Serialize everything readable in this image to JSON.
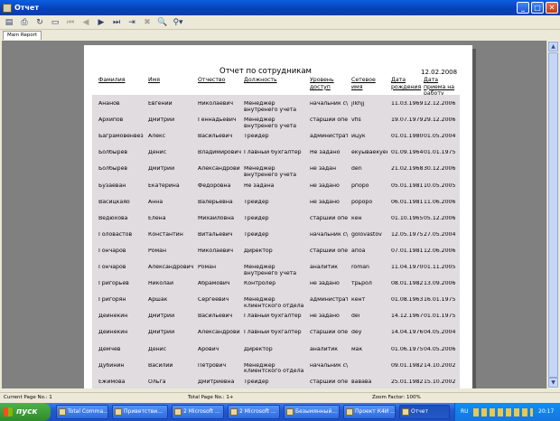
{
  "window": {
    "title": "Отчет"
  },
  "toolbar": {
    "buttons": [
      "export-icon",
      "print-icon",
      "refresh-icon",
      "page-setup-icon",
      "first-page-icon",
      "prev-page-icon",
      "next-page-icon",
      "last-page-icon",
      "goto-page-icon",
      "stop-icon",
      "search-icon",
      "group-tree-icon"
    ]
  },
  "tabs": [
    "Main Report"
  ],
  "report": {
    "title": "Отчет по сотрудникам",
    "date": "12.02.2008",
    "columns": [
      "Фамилия",
      "Имя",
      "Отчество",
      "Должность",
      "Уровень доступ",
      "Сетевое имя",
      "Дата рождения",
      "Дата приема на работу"
    ],
    "rows": [
      [
        "Ананов",
        "Евгений",
        "Николаевич",
        "Менеджер внутренего учета",
        "начальник с\\",
        "jlkhjj",
        "11.03.1969",
        "12.12.2006"
      ],
      [
        "Архипов",
        "Дмитрий",
        "Геннадьевич",
        "Менеджер внутренего учета",
        "старший опе",
        "vfis",
        "19.07.1979",
        "29.12.2006"
      ],
      [
        "Баграмовенвез",
        "Алекс",
        "Васильевич",
        "Трейдер",
        "администрат",
        "йцук",
        "01.01.1980",
        "01.05.2004"
      ],
      [
        "Болбырев",
        "Денис",
        "Владимирович",
        "Главный бухгалтер",
        "Не задано",
        "екуываекуек",
        "01.09.1964",
        "01.01.1975"
      ],
      [
        "Болбырев",
        "Дмитрий",
        "Александрови",
        "Менеджер внутренего учета",
        "не задан",
        "den",
        "21.02.1968",
        "30.12.2006"
      ],
      [
        "Бузаеван",
        "Екатерина",
        "Фёдоровна",
        "Не задана",
        "не задано",
        "рпорo",
        "05.01.1981",
        "10.05.2005"
      ],
      [
        "Васицкаяо",
        "Анна",
        "Валерьевна",
        "Трейдер",
        "не задано",
        "ророро",
        "06.01.1981",
        "11.06.2006"
      ],
      [
        "Ведюхова",
        "Елена",
        "Михайловна",
        "Трейдер",
        "старший опе",
        "кен",
        "01.10.1965",
        "05.12.2006"
      ],
      [
        "Головастов",
        "Константин",
        "Витальевич",
        "Трейдер",
        "начальник с\\",
        "golovastov",
        "12.05.1975",
        "27.05.2004"
      ],
      [
        "Гончаров",
        "Роман",
        "Николаевич",
        "Директор",
        "старший опе",
        "апоа",
        "07.01.1981",
        "12.06.2006"
      ],
      [
        "Гончаров",
        "Александрович",
        "Роман",
        "Менеджер внутренего учета",
        "аналитик",
        "roman",
        "11.04.1970",
        "01.11.2005"
      ],
      [
        "Григорьев",
        "Николай",
        "Абрамович",
        "Контролер",
        "не задано",
        "трьрол",
        "08.01.1982",
        "13.09.2006"
      ],
      [
        "Григорян",
        "Аршак",
        "Сергеевич",
        "Менеджер клиентского отдела",
        "администрат",
        "кент",
        "01.08.1963",
        "16.01.1975"
      ],
      [
        "Дейнекин",
        "Дмитрий",
        "Васильевич",
        "Главный бухгалтер",
        "не задано",
        "dei",
        "14.12.1967",
        "01.01.1975"
      ],
      [
        "Дейнекин",
        "Дмитрий",
        "Александрови",
        "Главный бухгалтер",
        "старший опе",
        "dey",
        "14.04.1976",
        "04.05.2004"
      ],
      [
        "Демчев",
        "Денис",
        "Арович",
        "Директор",
        "аналитик",
        "мак",
        "01.06.1975",
        "04.05.2006"
      ],
      [
        "Дубинин",
        "Василий",
        "Петрович",
        "Менеджер клиентского отдела",
        "начальник с\\",
        "",
        "09.01.1982",
        "14.10.2002"
      ],
      [
        "Ежимова",
        "Ольга",
        "Дмитриевна",
        "Трейдер",
        "старший опе",
        "вавава",
        "25.01.1982",
        "15.10.2002"
      ]
    ]
  },
  "status": {
    "current_page": "Current Page No.: 1",
    "total_page": "Total Page No.: 1+",
    "zoom": "Zoom Factor: 100%"
  },
  "taskbar": {
    "start_label": "пуск",
    "tasks": [
      "Total Comma...",
      "Приветстви...",
      "2 Microsoft ...",
      "2 Microsoft ...",
      "Безымянный...",
      "Проект К4И ...",
      "Отчет"
    ],
    "language": "RU",
    "clock": "20:17"
  }
}
